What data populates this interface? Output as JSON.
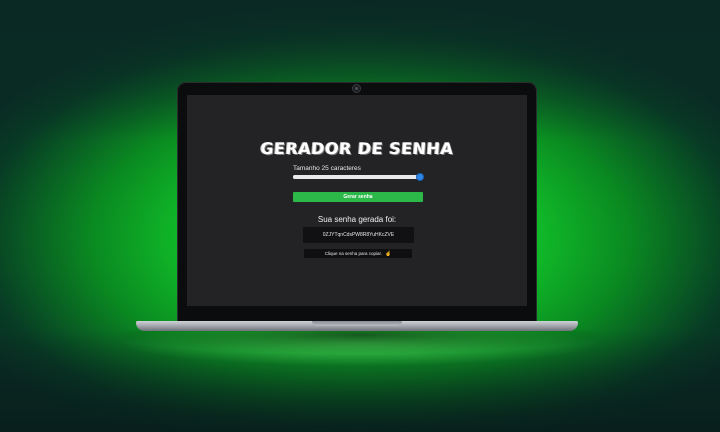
{
  "app": {
    "title": "GERADOR DE SENHA",
    "size_label": "Tamanho 25 caracteres",
    "slider": {
      "value": 25,
      "min": 1,
      "max": 25,
      "fraction": 1.0
    },
    "generate_button": "Gerar senha",
    "result_label": "Sua senha gerada foi:",
    "password": "0ZJYTqnCdsPW8R8YuHKcZVE",
    "copy_tooltip": "Clique na senha para copiar.",
    "copy_icon": "pointing-hand-icon"
  },
  "colors": {
    "background_green": "#1fe33a",
    "screen_bg": "#232326",
    "button_green": "#2db84a",
    "slider_thumb": "#2e86e6"
  }
}
